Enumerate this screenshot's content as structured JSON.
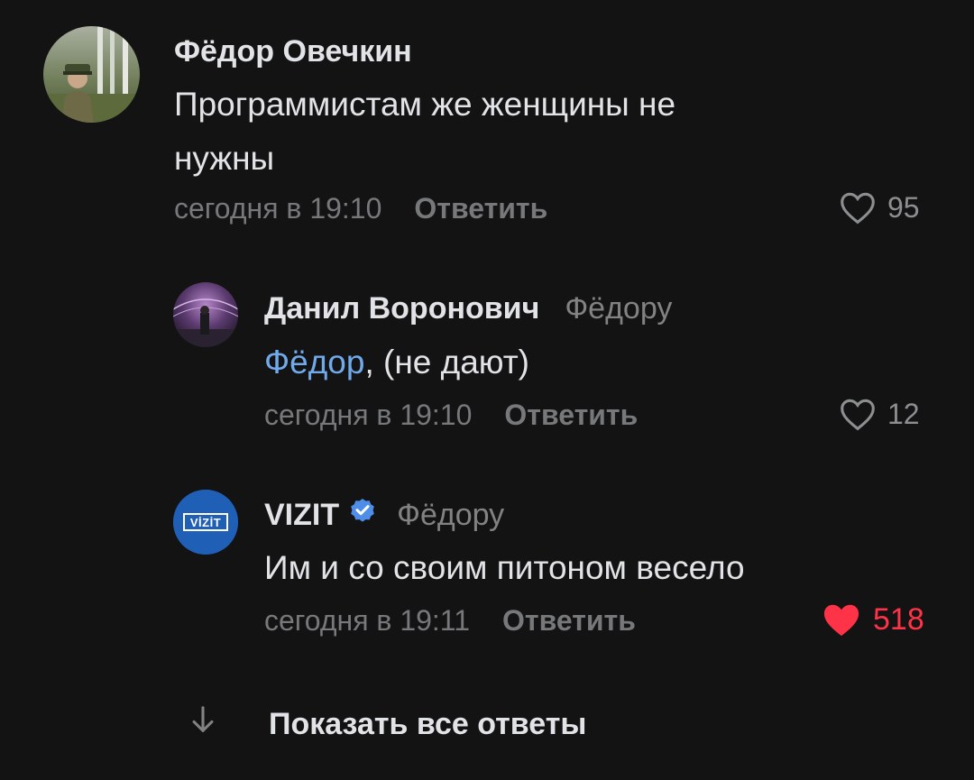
{
  "comments": [
    {
      "author": "Фёдор Овечкин",
      "text_line1": "Программистам же женщины не",
      "text_line2": "нужны",
      "time": "сегодня в 19:10",
      "reply_label": "Ответить",
      "likes": "95",
      "liked": false
    },
    {
      "author": "Данил Воронович",
      "reply_to": "Фёдору",
      "mention": "Фёдор",
      "text": ", (не дают)",
      "time": "сегодня в 19:10",
      "reply_label": "Ответить",
      "likes": "12",
      "liked": false
    },
    {
      "author": "VIZIT",
      "verified": true,
      "reply_to": "Фёдору",
      "text": "Им и со своим питоном весело",
      "time": "сегодня в 19:11",
      "reply_label": "Ответить",
      "likes": "518",
      "liked": true,
      "avatar_logo": "VİZİT"
    }
  ],
  "show_all": {
    "icon": "arrow-down-icon",
    "label": "Показать все ответы"
  },
  "colors": {
    "background": "#131314",
    "text": "#e1e3e6",
    "secondary": "#76787a",
    "mention": "#71aaeb",
    "like_active": "#ff3347",
    "verified": "#4f8ee8",
    "vizit_brand": "#1f5fb5"
  }
}
